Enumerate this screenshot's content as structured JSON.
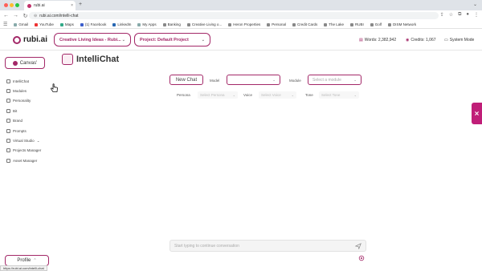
{
  "browser": {
    "tab_title": "rubi.ai",
    "tab_close": "×",
    "new_tab": "+",
    "url": "rubi.ai.com/intelli-chat",
    "bookmarks": [
      "Gmail",
      "YouTube",
      "Maps",
      "(1) Facebook",
      "LinkedIn",
      "My Apps",
      "Banking",
      "Creative Living o...",
      "Heron Properties",
      "Personal",
      "Credit Cards",
      "The Lake",
      "RUBI",
      "Golf",
      "DISM Network"
    ]
  },
  "header": {
    "logo_text": "rubi.ai",
    "canvas_select": "Creative Living Ideas - Rubi...",
    "project_select": "Project: Default Project",
    "words": "Words: 2,382,942",
    "credits": "Credits: 1,067",
    "system_mode": "System Mode"
  },
  "sidebar": {
    "canvas_label": "Canvas'",
    "items": [
      {
        "label": "IntelliChat"
      },
      {
        "label": "Modules"
      },
      {
        "label": "Personality"
      },
      {
        "label": "Bit"
      },
      {
        "label": "Brand"
      },
      {
        "label": "Prompts"
      },
      {
        "label": "Virtual Studio"
      },
      {
        "label": "Projects Manager"
      },
      {
        "label": "Asset Manager"
      }
    ],
    "virtual_studio_chevron": "⌄",
    "profile_label": "Profile",
    "status_url": "https://rubi.ai.com/intelli-chat"
  },
  "main": {
    "title": "IntelliChat",
    "new_chat": "New Chat",
    "model_label": "Model",
    "model_value": "",
    "module_label": "Module",
    "module_placeholder": "Select a module",
    "persona_label": "Persona",
    "persona_placeholder": "Select Persona",
    "voice_label": "Voice",
    "voice_placeholder": "Select Voice",
    "tone_label": "Tone",
    "tone_placeholder": "Select Tone",
    "composer_placeholder": "Start typing to continue conversation"
  },
  "colors": {
    "accent": "#a32868",
    "side_tab": "#c01e78"
  }
}
